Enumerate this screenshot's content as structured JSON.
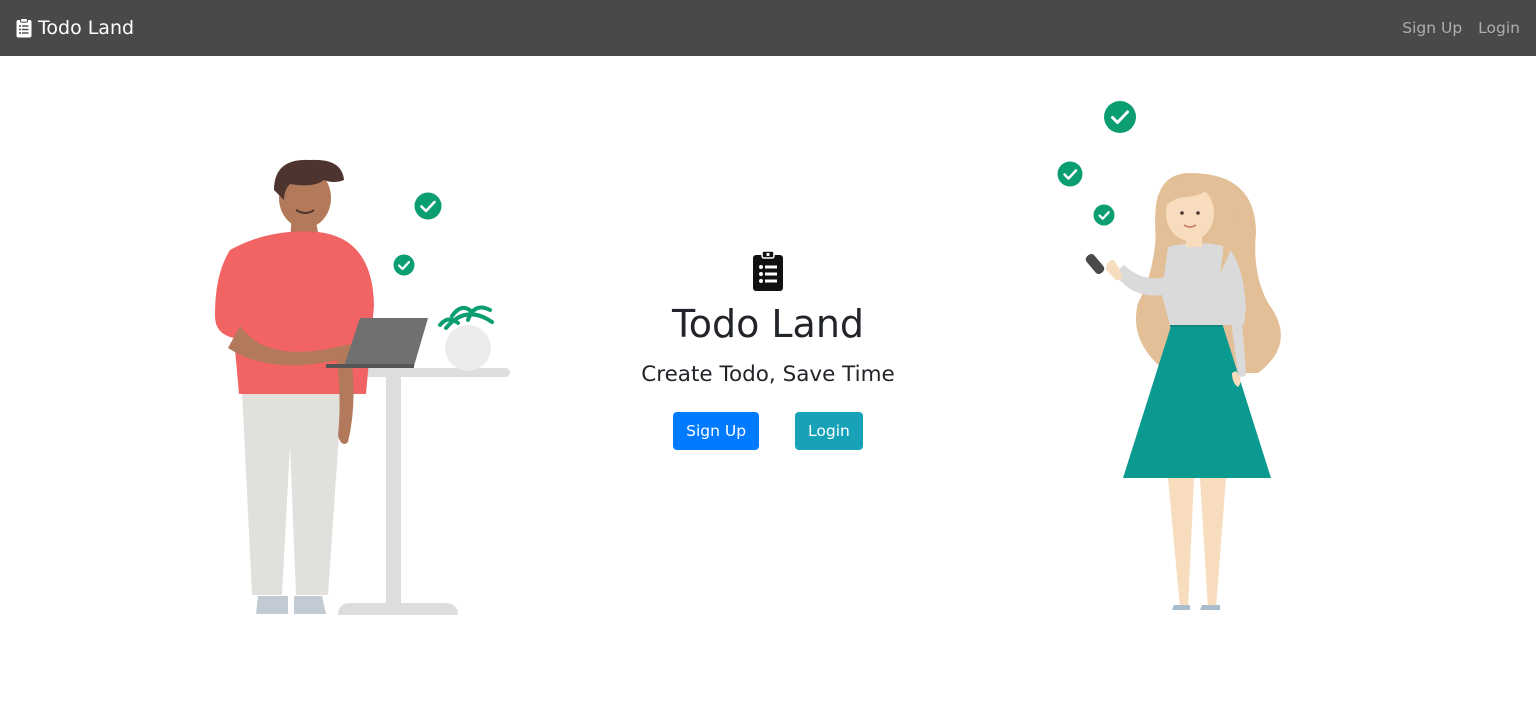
{
  "navbar": {
    "brand": "Todo Land",
    "links": [
      {
        "label": "Sign Up"
      },
      {
        "label": "Login"
      }
    ]
  },
  "hero": {
    "title": "Todo Land",
    "subtitle": "Create Todo, Save Time",
    "signup_label": "Sign Up",
    "login_label": "Login"
  },
  "icons": {
    "brand": "clipboard-list-icon",
    "hero": "clipboard-list-icon",
    "checks": "check-circle-icon"
  },
  "colors": {
    "navbar_bg": "#49494b",
    "primary": "#007bff",
    "info": "#17a2b8",
    "check_green": "#0a9e70"
  }
}
